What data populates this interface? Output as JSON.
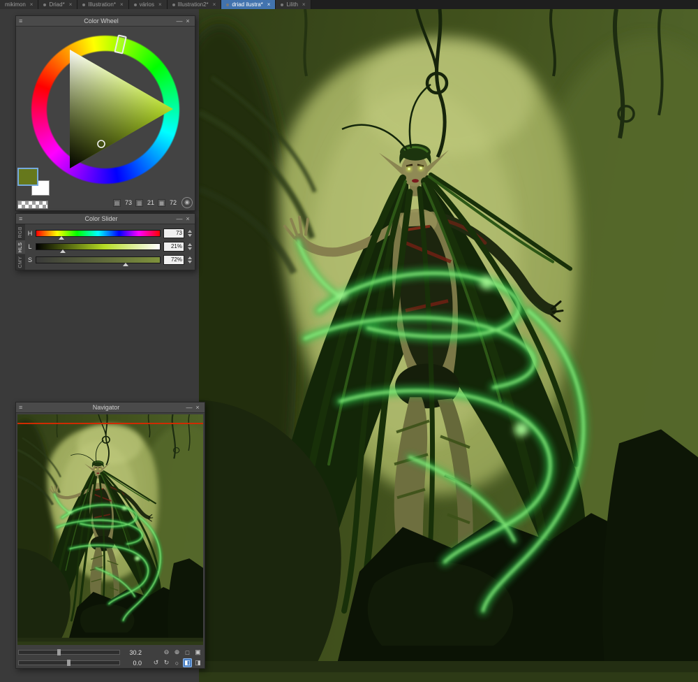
{
  "tabbar": {
    "tabs": [
      {
        "label": "mikimon",
        "close": "×",
        "active": false
      },
      {
        "label": "Driad*",
        "close": "×",
        "active": false
      },
      {
        "label": "Illustration*",
        "close": "×",
        "active": false
      },
      {
        "label": "vários",
        "close": "×",
        "active": false
      },
      {
        "label": "Illustration2*",
        "close": "×",
        "active": false
      },
      {
        "label": "driad ilustra*",
        "close": "×",
        "active": true
      },
      {
        "label": "Lilith",
        "close": "×",
        "active": false
      }
    ]
  },
  "panel_controls": {
    "menu": "≡",
    "minimize": "—",
    "close": "×"
  },
  "color_wheel": {
    "title": "Color Wheel",
    "primary_color": "#66781c",
    "secondary_color": "#ffffff",
    "readouts": [
      {
        "name": "hue",
        "icon": "▤",
        "value": "73"
      },
      {
        "name": "luminosity",
        "icon": "▥",
        "value": "21"
      },
      {
        "name": "saturation",
        "icon": "▦",
        "value": "72"
      }
    ],
    "mode_icon": "◉"
  },
  "color_slider": {
    "title": "Color Slider",
    "mode_tabs": [
      {
        "label": "RGB",
        "active": false
      },
      {
        "label": "HLS",
        "active": true
      },
      {
        "label": "CMY",
        "active": false
      }
    ],
    "sliders": [
      {
        "label": "H",
        "value": "73",
        "percent": 20
      },
      {
        "label": "L",
        "value": "21%",
        "percent": 21
      },
      {
        "label": "S",
        "value": "72%",
        "percent": 72
      }
    ]
  },
  "navigator": {
    "title": "Navigator",
    "zoom": {
      "value": "30.2",
      "percent": 40
    },
    "rotation": {
      "value": "0.0",
      "percent": 50
    },
    "zoom_buttons": [
      {
        "name": "zoom-out",
        "glyph": "⊖"
      },
      {
        "name": "zoom-in",
        "glyph": "⊕"
      },
      {
        "name": "fit-to-window",
        "glyph": "□"
      },
      {
        "name": "actual-size",
        "glyph": "▣"
      }
    ],
    "rotation_buttons": [
      {
        "name": "rotate-ccw",
        "glyph": "↺"
      },
      {
        "name": "rotate-cw",
        "glyph": "↻"
      },
      {
        "name": "reset-rotation",
        "glyph": "○"
      },
      {
        "name": "flip-horizontal",
        "glyph": "◧",
        "active": true
      },
      {
        "name": "flip-vertical",
        "glyph": "◨",
        "active": false
      }
    ]
  }
}
